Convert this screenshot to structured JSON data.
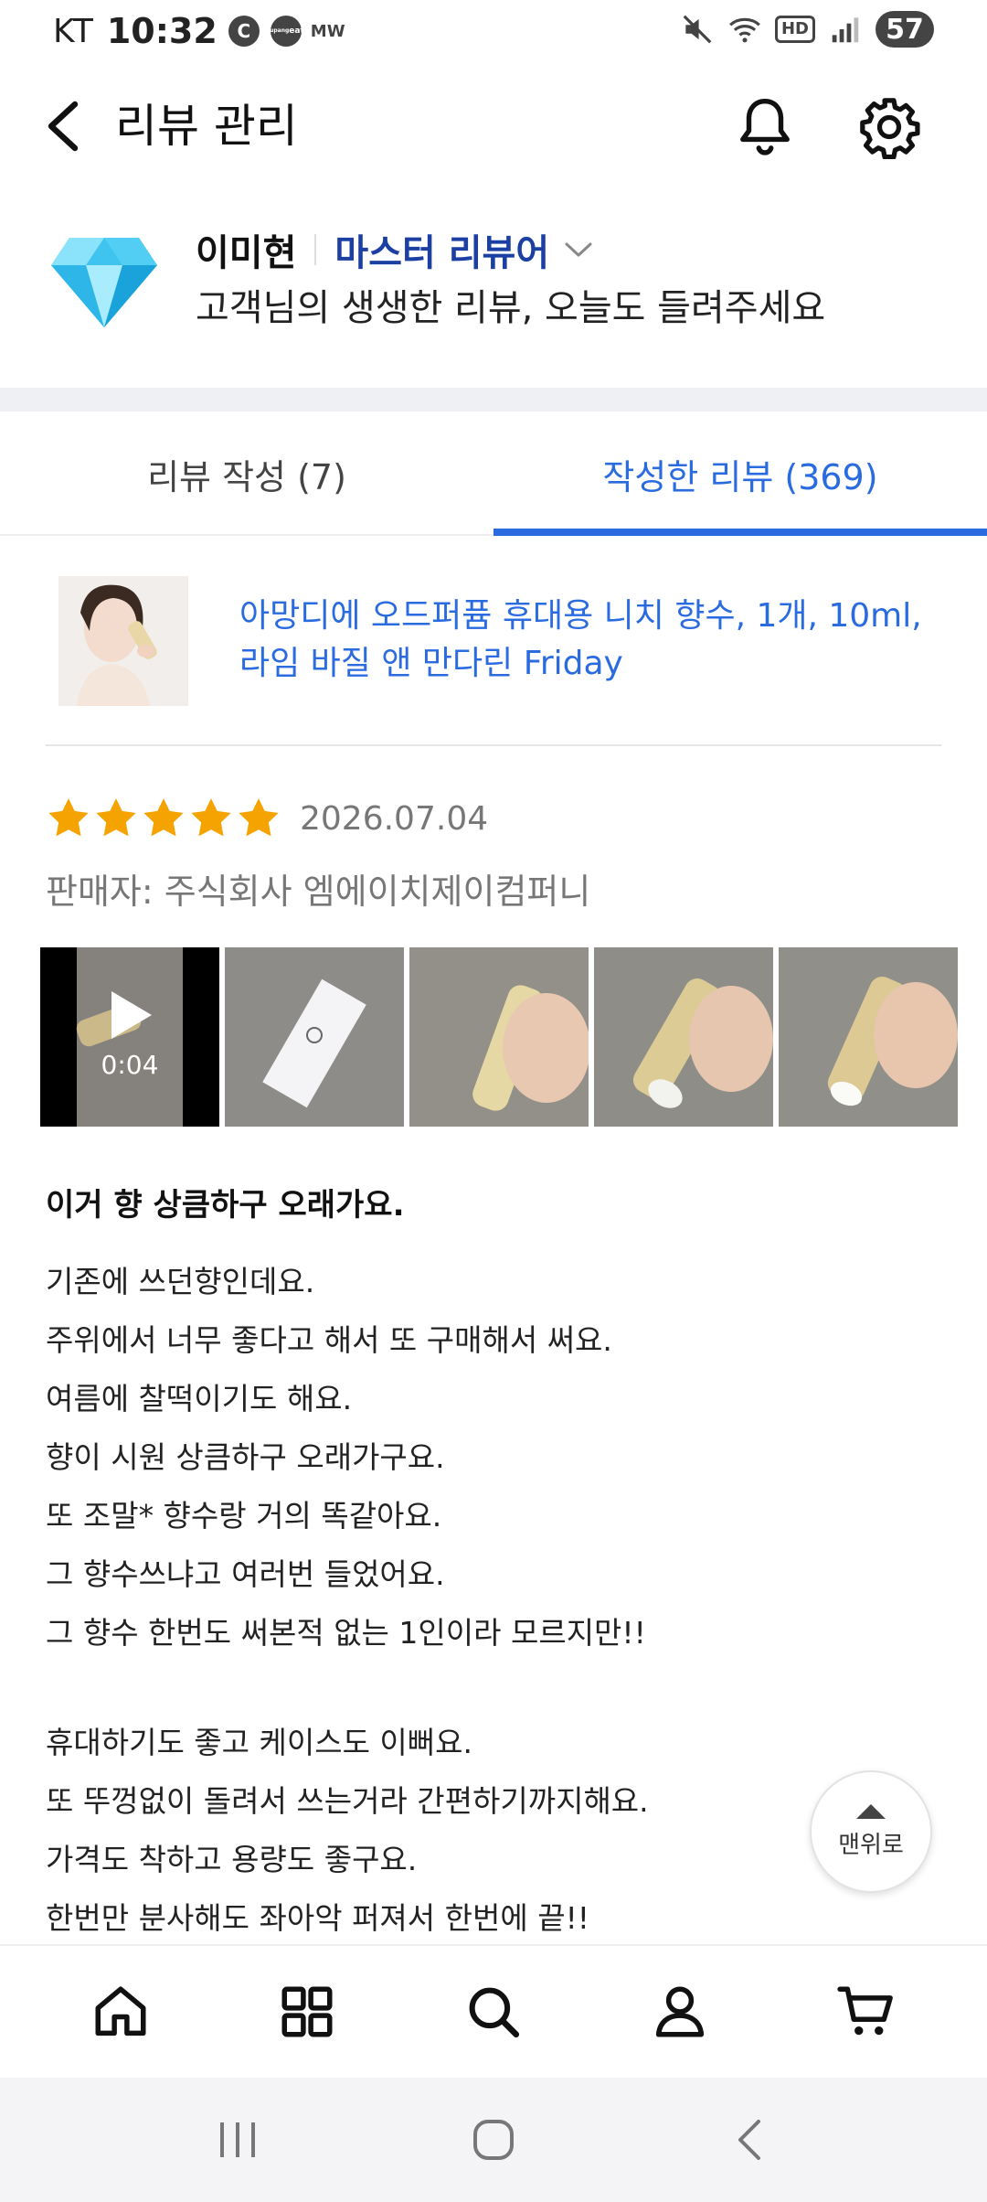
{
  "status_bar": {
    "carrier": "KT",
    "time": "10:32",
    "badge_c": "C",
    "badge_eats_top": "coupang",
    "badge_eats": "eats",
    "badge_mw": "MW",
    "hd": "HD",
    "battery": "57"
  },
  "header": {
    "title": "리뷰 관리"
  },
  "profile": {
    "name": "이미현",
    "grade": "마스터 리뷰어",
    "subtitle": "고객님의 생생한 리뷰, 오늘도 들려주세요",
    "grade_color": "#1b3fa3"
  },
  "tabs": [
    {
      "label": "리뷰 작성 (7)",
      "active": false
    },
    {
      "label": "작성한 리뷰 (369)",
      "active": true
    }
  ],
  "accent_color": "#2a6be0",
  "product": {
    "name": "아망디에 오드퍼퓸 휴대용 니치 향수, 1개, 10ml, 라임 바질 앤 만다린 Friday"
  },
  "review": {
    "rating": 5,
    "date": "2026.07.04",
    "seller": "판매자: 주식회사 엠에이치제이컴퍼니",
    "video_duration": "0:04",
    "title": "이거 향 상큼하구 오래가요.",
    "paragraph1": [
      "기존에 쓰던향인데요.",
      "주위에서 너무 좋다고 해서 또 구매해서 써요.",
      "여름에 찰떡이기도 해요.",
      "향이 시원 상큼하구 오래가구요.",
      "또 조말* 향수랑 거의 똑같아요.",
      "그 향수쓰냐고 여러번 들었어요.",
      "그 향수 한번도 써본적 없는 1인이라 모르지만!!"
    ],
    "paragraph2": [
      "휴대하기도 좋고 케이스도 이뻐요.",
      "또 뚜껑없이 돌려서 쓰는거라 간편하기까지해요.",
      "가격도 착하고 용량도 좋구요.",
      "한번만 분사해도 좌아악 퍼져서 한번에 끝!!"
    ]
  },
  "scroll_top": {
    "label": "맨위로"
  },
  "bottom_nav": [
    "home-icon",
    "category-icon",
    "search-icon",
    "account-icon",
    "cart-icon"
  ],
  "system_nav": [
    "recent-apps-icon",
    "home-button-icon",
    "back-icon"
  ]
}
